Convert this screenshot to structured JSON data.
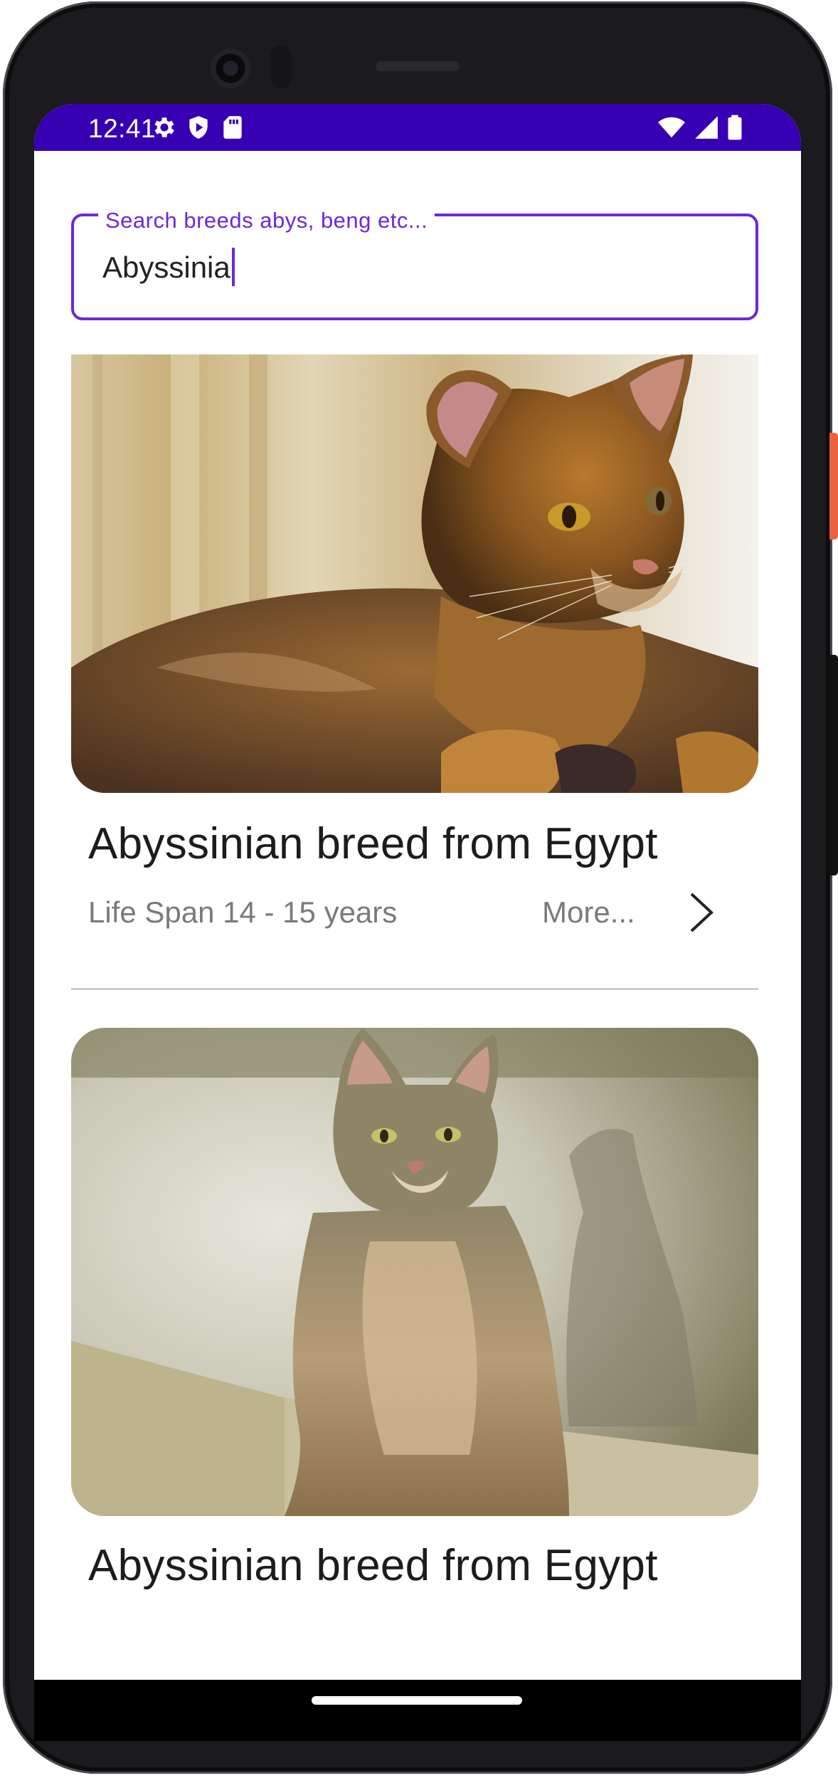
{
  "status_bar": {
    "time": "12:41",
    "left_icons": [
      "gear-icon",
      "shield-play-icon",
      "sd-card-icon"
    ],
    "right_icons": [
      "wifi-icon",
      "cell-signal-icon",
      "battery-icon"
    ],
    "background": "#3700b3"
  },
  "search": {
    "label": "Search breeds abys, beng etc...",
    "value": "Abyssinia",
    "accent": "#6d28d9"
  },
  "cards": [
    {
      "title": "Abyssinian breed from Egypt",
      "life_span": "Life  Span 14 - 15 years",
      "more_label": "More...",
      "image_alt": "Abyssinian cat lying down"
    },
    {
      "title": "Abyssinian breed from Egypt",
      "image_alt": "Abyssinian cat sitting upright"
    }
  ],
  "nav": {
    "home_indicator": "home-pill"
  }
}
